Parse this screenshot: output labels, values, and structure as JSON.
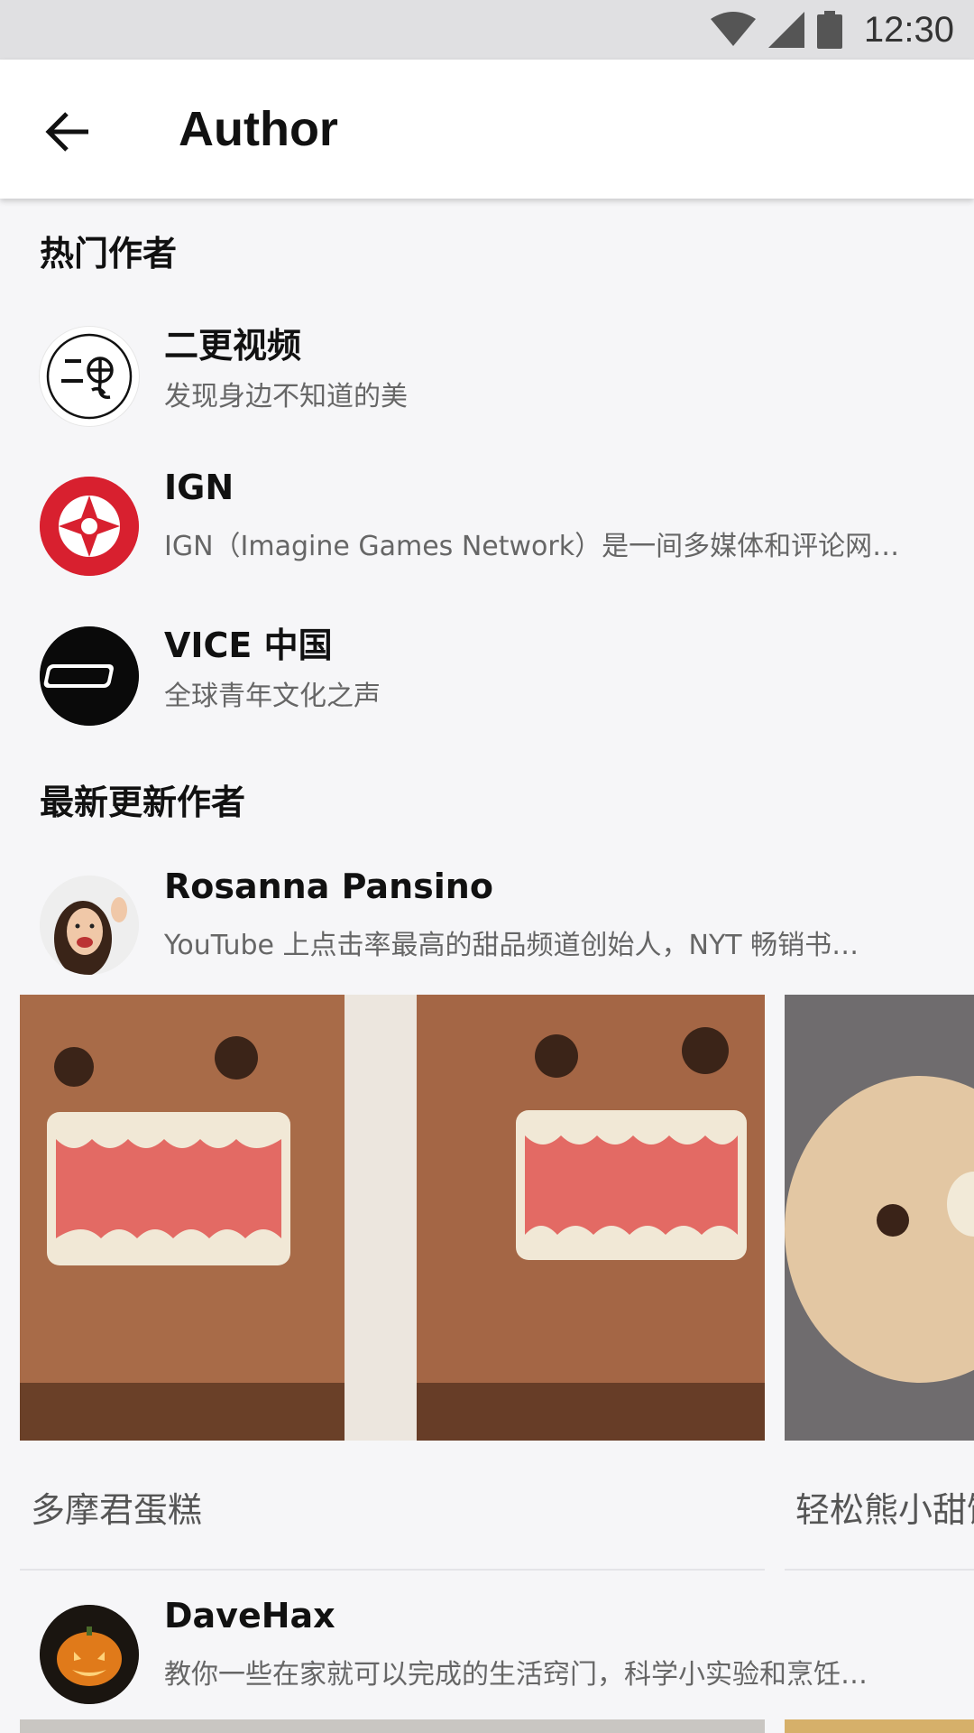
{
  "status_bar": {
    "time": "12:30",
    "icons": [
      "wifi-icon",
      "cell-signal-icon",
      "battery-icon"
    ]
  },
  "app_bar": {
    "back_icon": "arrow-back-icon",
    "title": "Author"
  },
  "sections": {
    "popular_title": "热门作者",
    "latest_title": "最新更新作者"
  },
  "popular_authors": [
    {
      "name": "二更视频",
      "desc": "发现身边不知道的美"
    },
    {
      "name": "IGN",
      "desc": "IGN（Imagine Games Network）是一间多媒体和评论网…"
    },
    {
      "name": "VICE 中国",
      "desc": "全球青年文化之声"
    }
  ],
  "latest_authors": [
    {
      "name": "Rosanna Pansino",
      "desc": "YouTube 上点击率最高的甜品频道创始人，NYT 畅销书…"
    },
    {
      "name": "DaveHax",
      "desc": "教你一些在家就可以完成的生活窍门，科学小实验和烹饪…"
    }
  ],
  "videos": [
    {
      "title": "多摩君蛋糕"
    },
    {
      "title": "轻松熊小甜饼"
    }
  ],
  "colors": {
    "background": "#f6f6f8",
    "app_bar": "#ffffff",
    "status_bar": "#e0e0e2",
    "ign_red": "#d8202f"
  }
}
